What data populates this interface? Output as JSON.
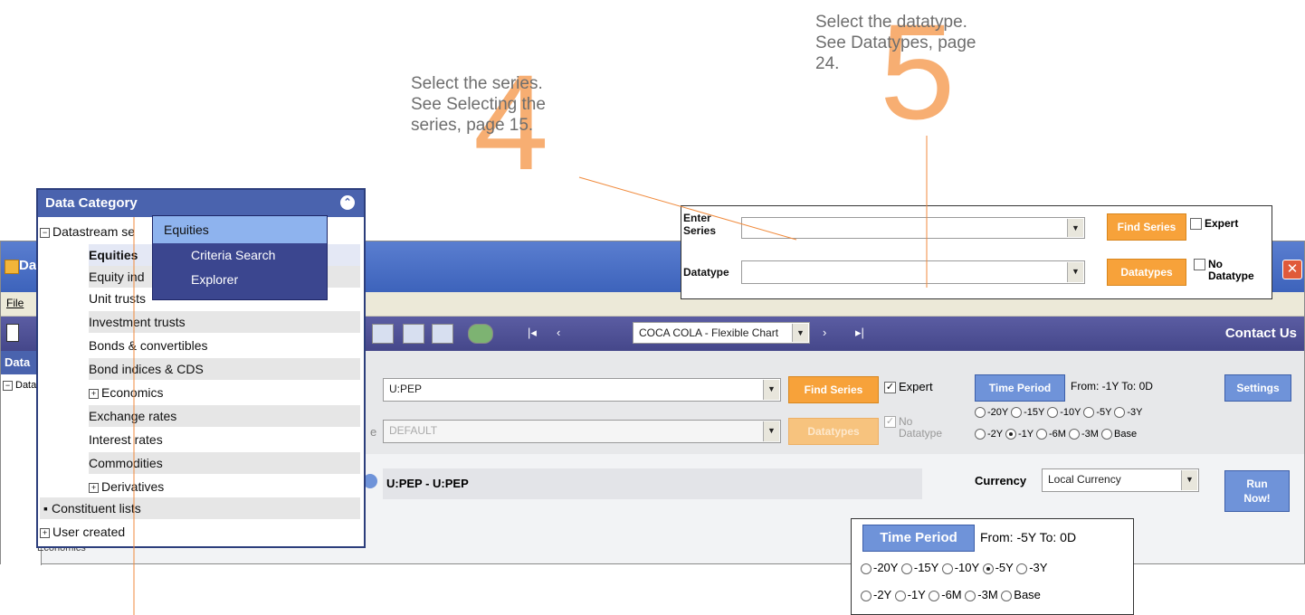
{
  "callouts": {
    "step4": {
      "number": "4",
      "line1": "Select the series.",
      "line2": "See Selecting the",
      "line3": "series, page 15."
    },
    "step5": {
      "number": "5",
      "line1": "Select the datatype.",
      "line2": "See Datatypes, page",
      "line3": "24."
    }
  },
  "window": {
    "title_partial": "Da",
    "menu_file": "File",
    "sidebar_title": "Data",
    "sidebar_tree_root": "Data",
    "sidebar_bottom_item": "Economics",
    "toolbar": {
      "chart_select": "COCA COLA - Flexible Chart",
      "contact": "Contact Us"
    },
    "series": {
      "value": "U:PEP",
      "find_label": "Find Series",
      "expert_label": "Expert",
      "expert_checked": "✓"
    },
    "datatype": {
      "prefix": "e",
      "value": "DEFAULT",
      "button_label": "Datatypes",
      "no_datatype_l1": "No",
      "no_datatype_l2": "Datatype"
    },
    "result_text": "U:PEP - U:PEP",
    "time_period": {
      "button": "Time Period",
      "range": "From: -1Y To: 0D",
      "row1": [
        "-20Y",
        "-15Y",
        "-10Y",
        "-5Y",
        "-3Y"
      ],
      "row2": [
        "-2Y",
        "-1Y",
        "-6M",
        "-3M",
        "Base"
      ]
    },
    "currency": {
      "label": "Currency",
      "value": "Local Currency"
    },
    "settings": "Settings",
    "run_now_l1": "Run",
    "run_now_l2": "Now!"
  },
  "data_category": {
    "title": "Data Category",
    "items": [
      {
        "label": "Datastream se",
        "expander": "-"
      },
      {
        "label": "Equities"
      },
      {
        "label": "Equity ind"
      },
      {
        "label": "Unit trusts"
      },
      {
        "label": "Investment trusts"
      },
      {
        "label": "Bonds & convertibles"
      },
      {
        "label": "Bond indices & CDS"
      },
      {
        "label": "Economics",
        "expander": "+"
      },
      {
        "label": "Exchange rates"
      },
      {
        "label": "Interest rates"
      },
      {
        "label": "Commodities"
      },
      {
        "label": "Derivatives",
        "expander": "+"
      },
      {
        "label": "Constituent lists"
      },
      {
        "label": "User created",
        "expander": "+"
      }
    ],
    "popup": {
      "header": "Equities",
      "items": [
        "Criteria Search",
        "Explorer"
      ]
    }
  },
  "series_panel": {
    "enter_l1": "Enter",
    "enter_l2": "Series",
    "find_label": "Find Series",
    "expert_label": "Expert",
    "datatype_label": "Datatype",
    "datatypes_button": "Datatypes",
    "no_l1": "No",
    "no_l2": "Datatype"
  },
  "time_panel": {
    "button": "Time Period",
    "range": "From: -5Y To: 0D",
    "row1": [
      "-20Y",
      "-15Y",
      "-10Y",
      "-5Y",
      "-3Y"
    ],
    "row2": [
      "-2Y",
      "-1Y",
      "-6M",
      "-3M",
      "Base"
    ]
  }
}
